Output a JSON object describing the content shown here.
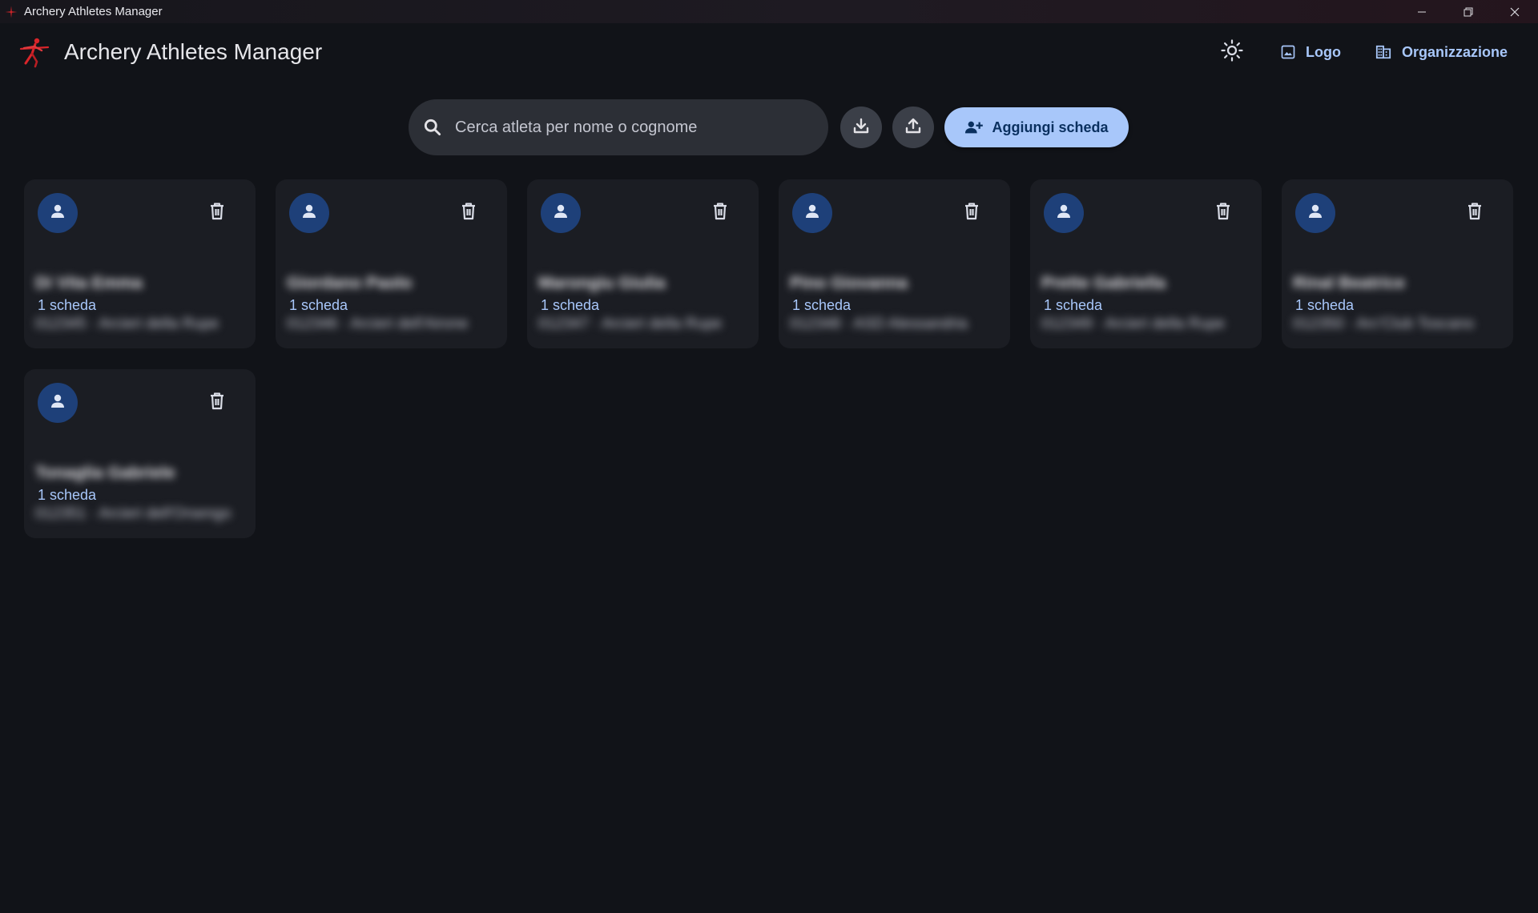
{
  "window": {
    "title": "Archery Athletes Manager",
    "accent": "#d9252a"
  },
  "header": {
    "title": "Archery Athletes Manager",
    "theme_toggle_icon": "sun-icon",
    "logo_label": "Logo",
    "organization_label": "Organizzazione",
    "link_color": "#a8c7fa"
  },
  "toolbar": {
    "search_placeholder": "Cerca atleta per nome o cognome",
    "search_value": "",
    "download_icon": "download-icon",
    "upload_icon": "upload-icon",
    "add_label": "Aggiungi scheda",
    "add_color": "#a8c7fa"
  },
  "athletes": [
    {
      "name": "Di Vita Emma",
      "sheets": "1 scheda",
      "meta": "012345 · Arcieri della Rupe"
    },
    {
      "name": "Giordano Paolo",
      "sheets": "1 scheda",
      "meta": "012346 · Arcieri dell'Airone"
    },
    {
      "name": "Marongiu Giulia",
      "sheets": "1 scheda",
      "meta": "012347 · Arcieri della Rupe"
    },
    {
      "name": "Pino Giovanna",
      "sheets": "1 scheda",
      "meta": "012348 · ASD Alessandria"
    },
    {
      "name": "Prette Gabriella",
      "sheets": "1 scheda",
      "meta": "012349 · Arcieri della Rupe"
    },
    {
      "name": "Rinal Beatrice",
      "sheets": "1 scheda",
      "meta": "012350 · Arc'Club Toscano"
    },
    {
      "name": "Tonaglia Gabriele",
      "sheets": "1 scheda",
      "meta": "012351 · Arcieri dell'Orsengo"
    }
  ]
}
